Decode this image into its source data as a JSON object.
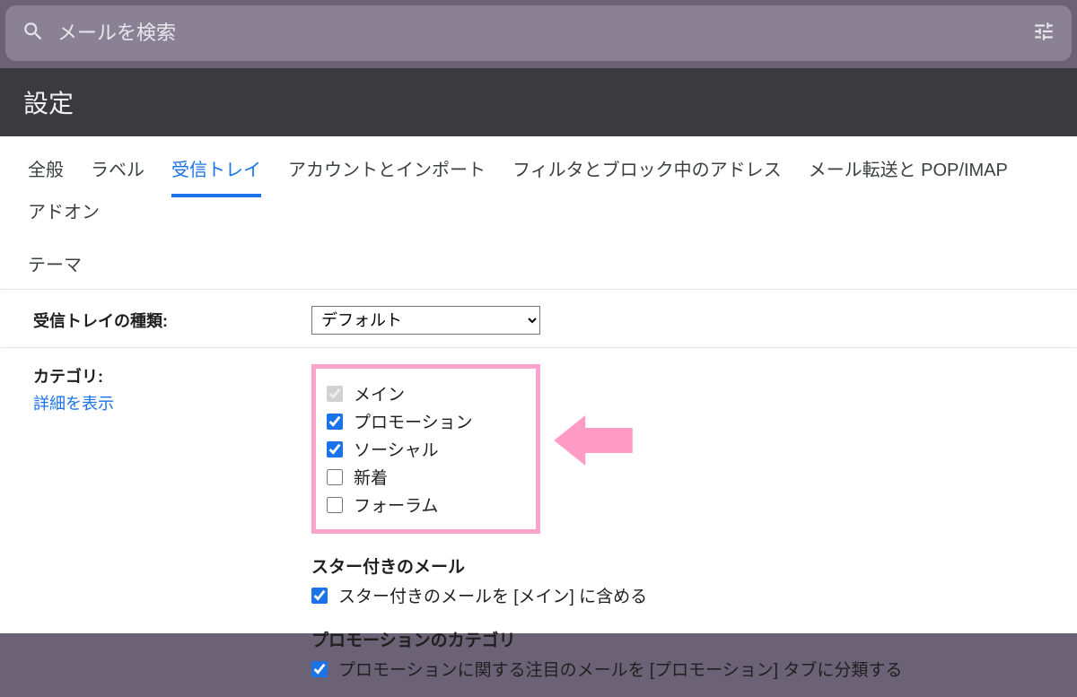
{
  "search": {
    "placeholder": "メールを検索"
  },
  "settings_header": "設定",
  "tabs": {
    "row1": [
      {
        "label": "全般",
        "active": false,
        "name": "tab-general"
      },
      {
        "label": "ラベル",
        "active": false,
        "name": "tab-labels"
      },
      {
        "label": "受信トレイ",
        "active": true,
        "name": "tab-inbox"
      },
      {
        "label": "アカウントとインポート",
        "active": false,
        "name": "tab-accounts"
      },
      {
        "label": "フィルタとブロック中のアドレス",
        "active": false,
        "name": "tab-filters"
      },
      {
        "label": "メール転送と POP/IMAP",
        "active": false,
        "name": "tab-forwarding"
      },
      {
        "label": "アドオン",
        "active": false,
        "name": "tab-addons"
      }
    ],
    "row2": [
      {
        "label": "テーマ",
        "active": false,
        "name": "tab-theme"
      }
    ]
  },
  "inbox_type": {
    "label": "受信トレイの種類:",
    "selected": "デフォルト"
  },
  "categories": {
    "label": "カテゴリ:",
    "link": "詳細を表示",
    "items": [
      {
        "label": "メイン",
        "checked": true,
        "disabled": true,
        "name": "category-primary"
      },
      {
        "label": "プロモーション",
        "checked": true,
        "disabled": false,
        "name": "category-promotions"
      },
      {
        "label": "ソーシャル",
        "checked": true,
        "disabled": false,
        "name": "category-social"
      },
      {
        "label": "新着",
        "checked": false,
        "disabled": false,
        "name": "category-updates"
      },
      {
        "label": "フォーラム",
        "checked": false,
        "disabled": false,
        "name": "category-forums"
      }
    ]
  },
  "starred": {
    "title": "スター付きのメール",
    "option_label": "スター付きのメールを [メイン] に含める",
    "checked": true
  },
  "promo_category": {
    "title": "プロモーションのカテゴリ",
    "option_label": "プロモーションに関する注目のメールを [プロモーション] タブに分類する",
    "checked": true
  },
  "colors": {
    "accent": "#1a73e8",
    "highlight_border": "#f8a4cd",
    "arrow_fill": "#ff9cc5"
  }
}
